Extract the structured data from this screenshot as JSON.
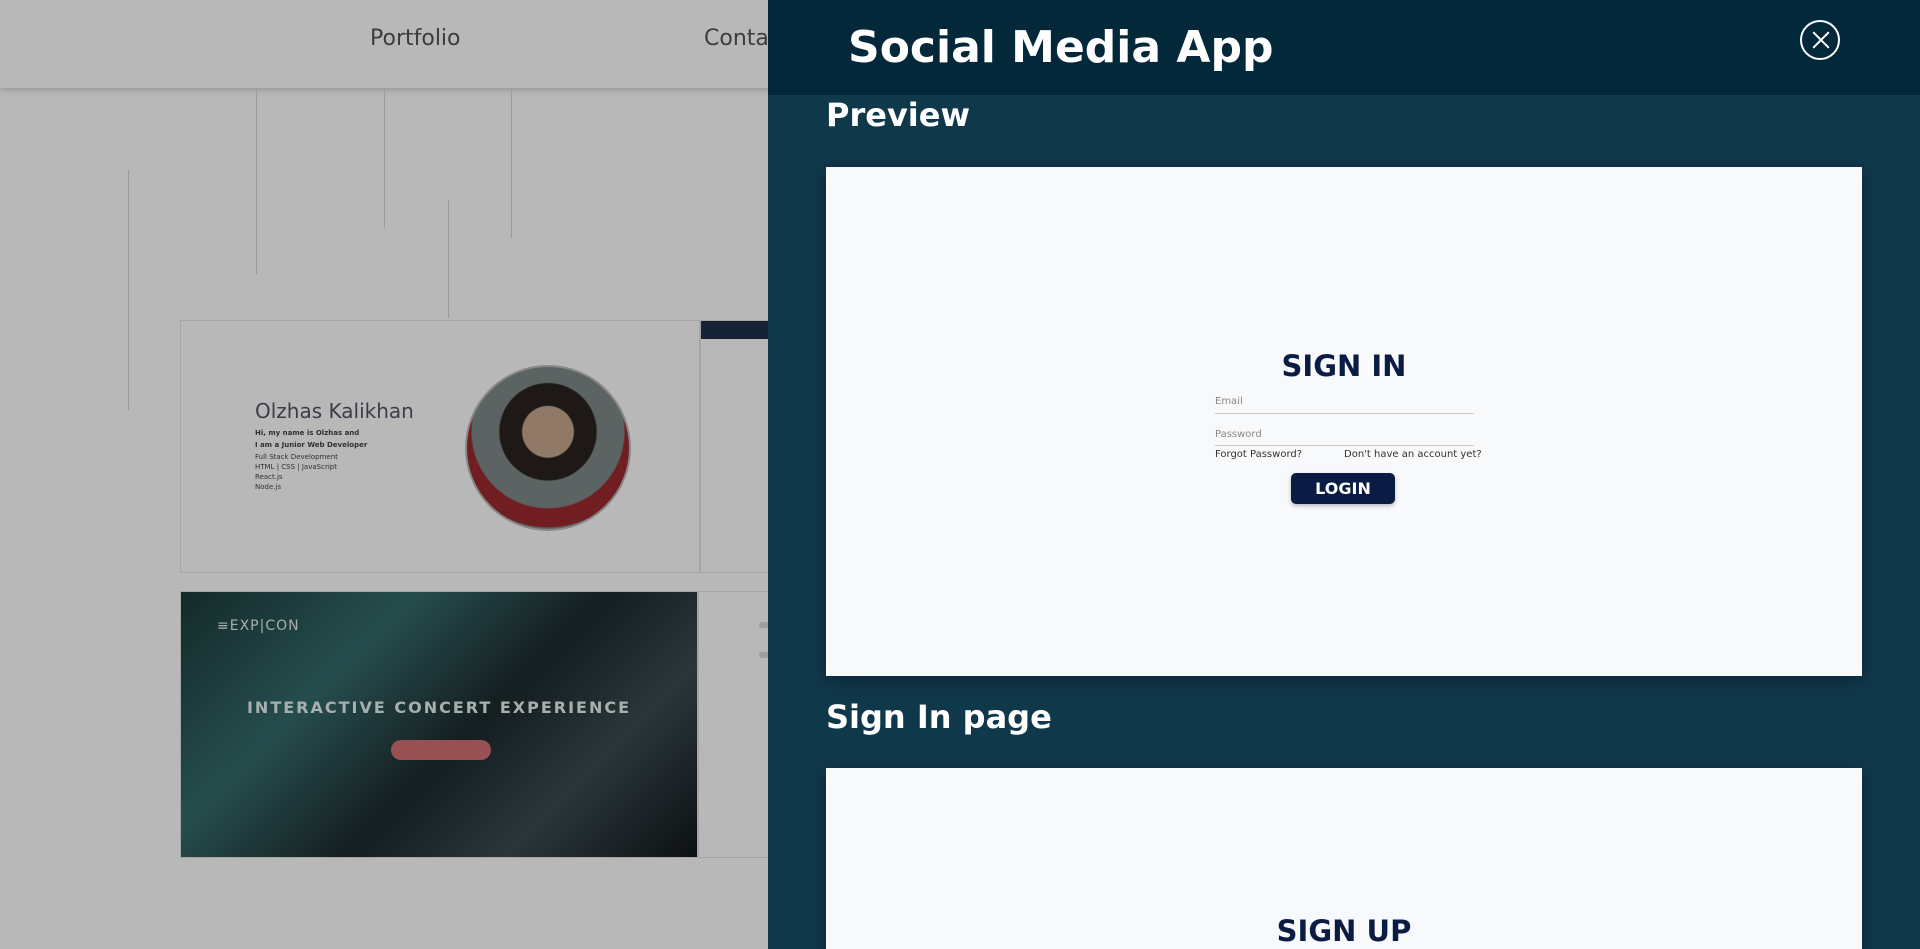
{
  "background": {
    "nav_links": [
      "Portfolio",
      "Conta"
    ],
    "bio_card": {
      "name": "Olzhas Kalikhan",
      "lines": [
        "Hi, my name is Olzhas and",
        "I am a Junior Web Developer",
        "Full Stack Development",
        "HTML | CSS | JavaScript",
        "React.js",
        "Node.js"
      ]
    },
    "concert_card": {
      "logo": "≡EXP|CON",
      "title": "INTERACTIVE CONCERT EXPERIENCE"
    }
  },
  "modal": {
    "title": "Social Media App",
    "sections": [
      {
        "heading": "Preview"
      },
      {
        "heading": "Sign In page"
      }
    ],
    "preview": {
      "form_title": "SIGN IN",
      "email_placeholder": "Email",
      "password_placeholder": "Password",
      "forgot_link": "Forgot Password?",
      "signup_link": "Don't have an account yet?",
      "login_button": "LOGIN"
    },
    "signin_page": {
      "form_title": "SIGN UP"
    }
  },
  "colors": {
    "modal_bg": "#10384b",
    "modal_header_bg": "#03283a",
    "form_primary": "#0b1c44"
  }
}
